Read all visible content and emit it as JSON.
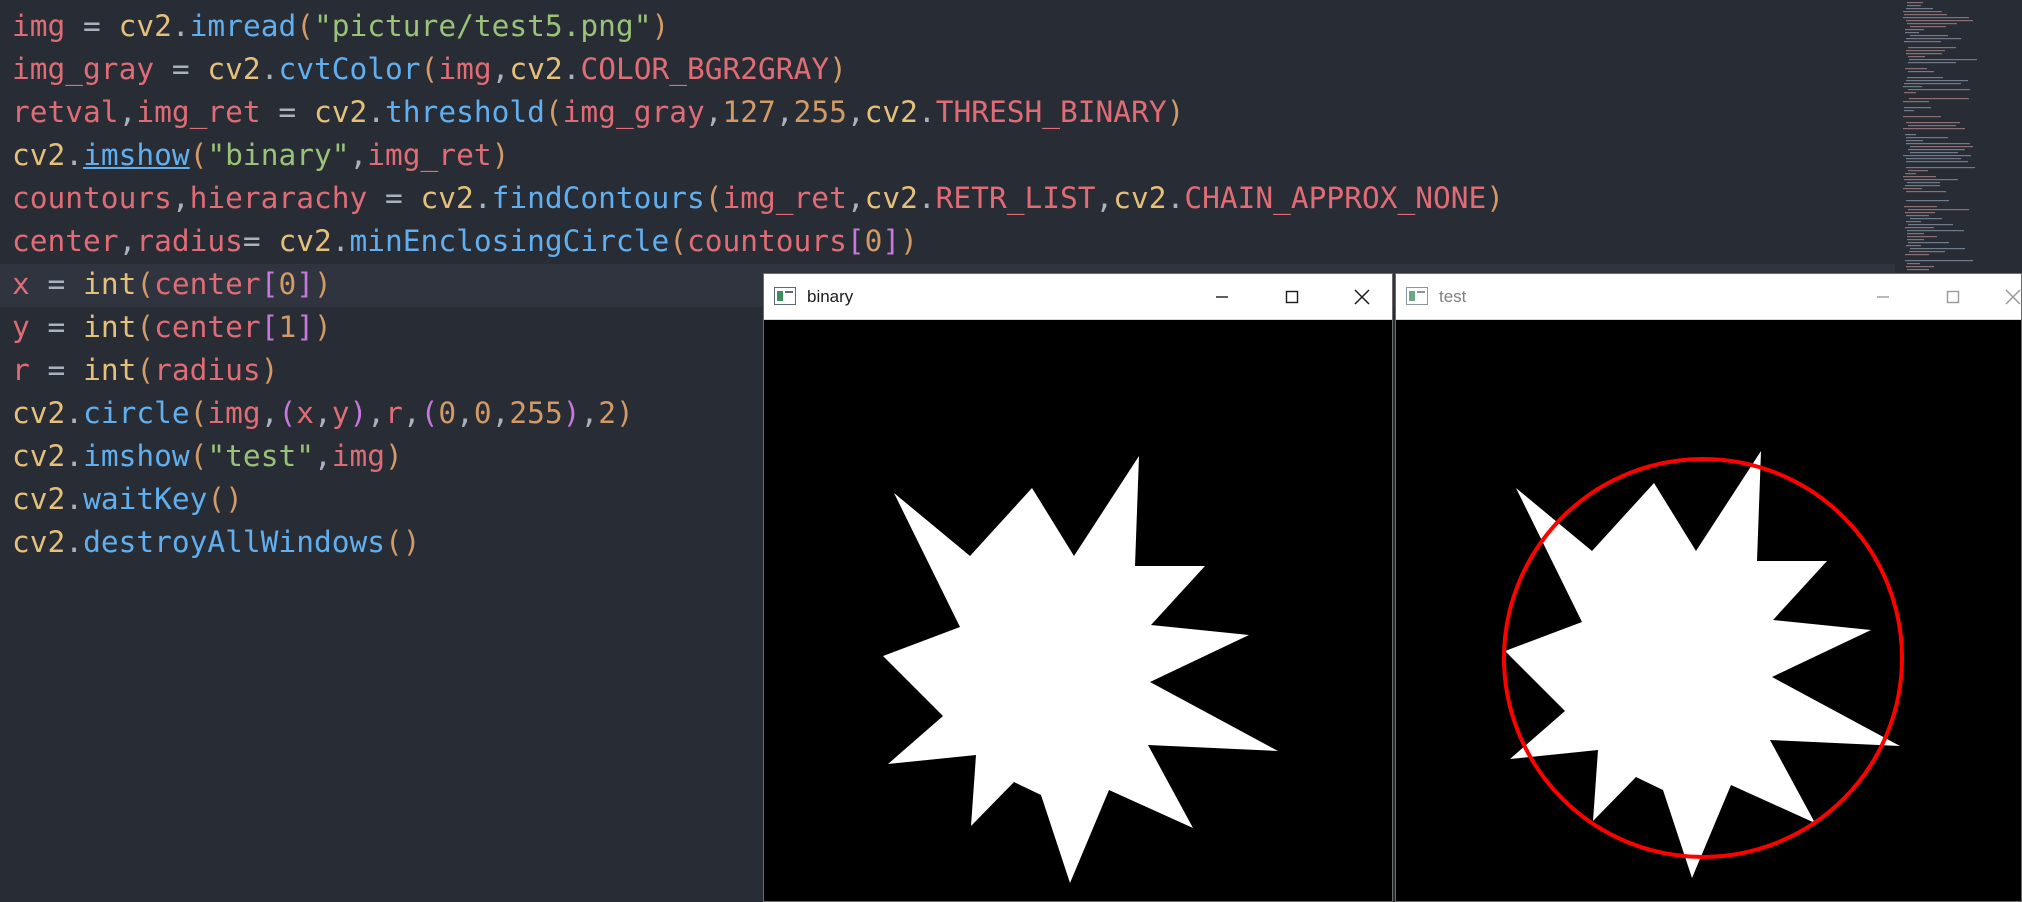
{
  "editor": {
    "lines": [
      [
        [
          "img",
          "t-var"
        ],
        [
          " = ",
          "t-pun"
        ],
        [
          "cv2",
          "t-kw"
        ],
        [
          ".",
          "t-pun"
        ],
        [
          "imread",
          "t-fn"
        ],
        [
          "(",
          "t-p1"
        ],
        [
          "\"picture/test5.png\"",
          "t-str"
        ],
        [
          ")",
          "t-p1"
        ]
      ],
      [
        [
          "img_gray",
          "t-var"
        ],
        [
          " = ",
          "t-pun"
        ],
        [
          "cv2",
          "t-kw"
        ],
        [
          ".",
          "t-pun"
        ],
        [
          "cvtColor",
          "t-fn"
        ],
        [
          "(",
          "t-p1"
        ],
        [
          "img",
          "t-var"
        ],
        [
          ",",
          "t-pun"
        ],
        [
          "cv2",
          "t-kw"
        ],
        [
          ".",
          "t-pun"
        ],
        [
          "COLOR_BGR2GRAY",
          "t-var"
        ],
        [
          ")",
          "t-p1"
        ]
      ],
      [
        [
          "retval",
          "t-var"
        ],
        [
          ",",
          "t-pun"
        ],
        [
          "img_ret",
          "t-var"
        ],
        [
          " = ",
          "t-pun"
        ],
        [
          "cv2",
          "t-kw"
        ],
        [
          ".",
          "t-pun"
        ],
        [
          "threshold",
          "t-fn"
        ],
        [
          "(",
          "t-p1"
        ],
        [
          "img_gray",
          "t-var"
        ],
        [
          ",",
          "t-pun"
        ],
        [
          "127",
          "t-num"
        ],
        [
          ",",
          "t-pun"
        ],
        [
          "255",
          "t-num"
        ],
        [
          ",",
          "t-pun"
        ],
        [
          "cv2",
          "t-kw"
        ],
        [
          ".",
          "t-pun"
        ],
        [
          "THRESH_BINARY",
          "t-var"
        ],
        [
          ")",
          "t-p1"
        ]
      ],
      [
        [
          "cv2",
          "t-kw"
        ],
        [
          ".",
          "t-pun"
        ],
        [
          "imshow",
          "t-link"
        ],
        [
          "(",
          "t-p1"
        ],
        [
          "\"binary\"",
          "t-str"
        ],
        [
          ",",
          "t-pun"
        ],
        [
          "img_ret",
          "t-var"
        ],
        [
          ")",
          "t-p1"
        ]
      ],
      [
        [
          "countours",
          "t-var"
        ],
        [
          ",",
          "t-pun"
        ],
        [
          "hierarachy",
          "t-var"
        ],
        [
          " = ",
          "t-pun"
        ],
        [
          "cv2",
          "t-kw"
        ],
        [
          ".",
          "t-pun"
        ],
        [
          "findContours",
          "t-fn"
        ],
        [
          "(",
          "t-p1"
        ],
        [
          "img_ret",
          "t-var"
        ],
        [
          ",",
          "t-pun"
        ],
        [
          "cv2",
          "t-kw"
        ],
        [
          ".",
          "t-pun"
        ],
        [
          "RETR_LIST",
          "t-var"
        ],
        [
          ",",
          "t-pun"
        ],
        [
          "cv2",
          "t-kw"
        ],
        [
          ".",
          "t-pun"
        ],
        [
          "CHAIN_APPROX_NONE",
          "t-var"
        ],
        [
          ")",
          "t-p1"
        ]
      ],
      [
        [
          "center",
          "t-var"
        ],
        [
          ",",
          "t-pun"
        ],
        [
          "radius",
          "t-var"
        ],
        [
          "= ",
          "t-pun"
        ],
        [
          "cv2",
          "t-kw"
        ],
        [
          ".",
          "t-pun"
        ],
        [
          "minEnclosingCircle",
          "t-fn"
        ],
        [
          "(",
          "t-p1"
        ],
        [
          "countours",
          "t-var"
        ],
        [
          "[",
          "t-p2"
        ],
        [
          "0",
          "t-num"
        ],
        [
          "]",
          "t-p2"
        ],
        [
          ")",
          "t-p1"
        ]
      ],
      [
        [
          "x",
          "t-var"
        ],
        [
          " = ",
          "t-pun"
        ],
        [
          "int",
          "t-kw"
        ],
        [
          "(",
          "t-p1"
        ],
        [
          "center",
          "t-var"
        ],
        [
          "[",
          "t-p2"
        ],
        [
          "0",
          "t-num"
        ],
        [
          "]",
          "t-p2"
        ],
        [
          ")",
          "t-p1"
        ]
      ],
      [
        [
          "y",
          "t-var"
        ],
        [
          " = ",
          "t-pun"
        ],
        [
          "int",
          "t-kw"
        ],
        [
          "(",
          "t-p1"
        ],
        [
          "center",
          "t-var"
        ],
        [
          "[",
          "t-p2"
        ],
        [
          "1",
          "t-num"
        ],
        [
          "]",
          "t-p2"
        ],
        [
          ")",
          "t-p1"
        ]
      ],
      [
        [
          "r",
          "t-var"
        ],
        [
          " = ",
          "t-pun"
        ],
        [
          "int",
          "t-kw"
        ],
        [
          "(",
          "t-p1"
        ],
        [
          "radius",
          "t-var"
        ],
        [
          ")",
          "t-p1"
        ]
      ],
      [
        [
          "cv2",
          "t-kw"
        ],
        [
          ".",
          "t-pun"
        ],
        [
          "circle",
          "t-fn"
        ],
        [
          "(",
          "t-p1"
        ],
        [
          "img",
          "t-var"
        ],
        [
          ",",
          "t-pun"
        ],
        [
          "(",
          "t-p2"
        ],
        [
          "x",
          "t-var"
        ],
        [
          ",",
          "t-pun"
        ],
        [
          "y",
          "t-var"
        ],
        [
          ")",
          "t-p2"
        ],
        [
          ",",
          "t-pun"
        ],
        [
          "r",
          "t-var"
        ],
        [
          ",",
          "t-pun"
        ],
        [
          "(",
          "t-p2"
        ],
        [
          "0",
          "t-num"
        ],
        [
          ",",
          "t-pun"
        ],
        [
          "0",
          "t-num"
        ],
        [
          ",",
          "t-pun"
        ],
        [
          "255",
          "t-num"
        ],
        [
          ")",
          "t-p2"
        ],
        [
          ",",
          "t-pun"
        ],
        [
          "2",
          "t-num"
        ],
        [
          ")",
          "t-p1"
        ]
      ],
      [
        [
          "cv2",
          "t-kw"
        ],
        [
          ".",
          "t-pun"
        ],
        [
          "imshow",
          "t-fn"
        ],
        [
          "(",
          "t-p1"
        ],
        [
          "\"test\"",
          "t-str"
        ],
        [
          ",",
          "t-pun"
        ],
        [
          "img",
          "t-var"
        ],
        [
          ")",
          "t-p1"
        ]
      ],
      [
        [
          "cv2",
          "t-kw"
        ],
        [
          ".",
          "t-pun"
        ],
        [
          "waitKey",
          "t-fn"
        ],
        [
          "(",
          "t-p1"
        ],
        [
          ")",
          "t-p1"
        ]
      ],
      [
        [
          "cv2",
          "t-kw"
        ],
        [
          ".",
          "t-pun"
        ],
        [
          "destroyAllWindows",
          "t-fn"
        ],
        [
          "(",
          "t-p1"
        ],
        [
          ")",
          "t-p1"
        ]
      ]
    ],
    "current_line": 7
  },
  "windows": {
    "binary": {
      "title": "binary",
      "active": true
    },
    "test": {
      "title": "test",
      "active": false
    }
  },
  "colors": {
    "editor_bg": "#282c34",
    "enclosing_circle": "#ff0000",
    "shape_fill": "#ffffff",
    "image_bg": "#000000"
  },
  "icons": [
    "app-window-icon",
    "minimize-icon",
    "maximize-icon",
    "close-icon"
  ]
}
